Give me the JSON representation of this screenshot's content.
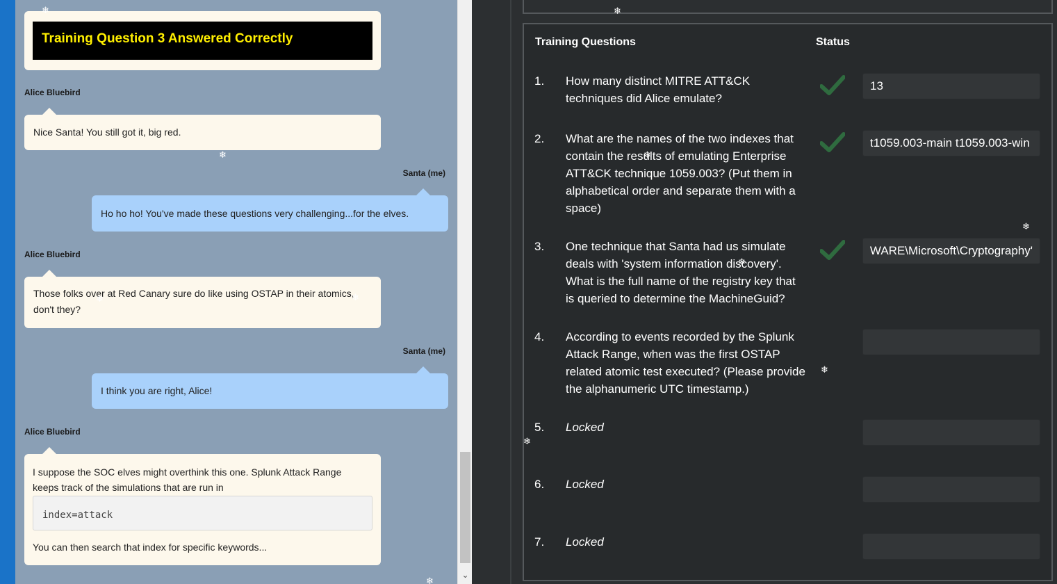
{
  "chat": {
    "banner_text": "Training Question 3 Answered Correctly",
    "messages": [
      {
        "sender": "Alice Bluebird",
        "text": "Nice Santa! You still got it, big red."
      },
      {
        "sender": "Santa (me)",
        "text": "Ho ho ho! You've made these questions very challenging...for the elves."
      },
      {
        "sender": "Alice Bluebird",
        "text_line1": "Those folks over at Red Canary sure do like using OSTAP in their atomics,",
        "text_line2": "don't they?"
      },
      {
        "sender": "Santa (me)",
        "text": "I think you are right, Alice!"
      },
      {
        "sender": "Alice Bluebird",
        "text_line1": "I suppose the SOC elves might overthink this one. Splunk Attack Range",
        "text_line2": "keeps track of the simulations that are run in",
        "code": "index=attack",
        "text_after": "You can then search that index for specific keywords..."
      }
    ]
  },
  "questions_panel": {
    "header_questions": "Training Questions",
    "header_status": "Status",
    "questions": [
      {
        "num": "1.",
        "text": "How many distinct MITRE ATT&CK techniques did Alice emulate?",
        "status": "check-icon",
        "answer": "13"
      },
      {
        "num": "2.",
        "text": "What are the names of the two indexes that contain the results of emulating Enterprise ATT&CK technique 1059.003? (Put them in alphabetical order and separate them with a space)",
        "status": "check-icon",
        "answer": "t1059.003-main t1059.003-win"
      },
      {
        "num": "3.",
        "text": "One technique that Santa had us simulate deals with 'system information discovery'. What is the full name of the registry key that is queried to determine the MachineGuid?",
        "status": "check-icon",
        "answer": "'WARE\\Microsoft\\Cryptography"
      },
      {
        "num": "4.",
        "text": "According to events recorded by the Splunk Attack Range, when was the first OSTAP related atomic test executed? (Please provide the alphanumeric UTC timestamp.)",
        "status": "",
        "answer": ""
      },
      {
        "num": "5.",
        "text": "Locked",
        "status": "",
        "answer": ""
      },
      {
        "num": "6.",
        "text": "Locked",
        "status": "",
        "answer": ""
      },
      {
        "num": "7.",
        "text": "Locked",
        "status": "",
        "answer": ""
      }
    ]
  },
  "colors": {
    "chat_bg": "#8a9fb5",
    "bubble_them": "#fdf8ec",
    "bubble_me": "#a9d1fb",
    "banner_text": "#ffef00",
    "check": "#2f6b3f",
    "panel_bg": "#272a2c"
  }
}
